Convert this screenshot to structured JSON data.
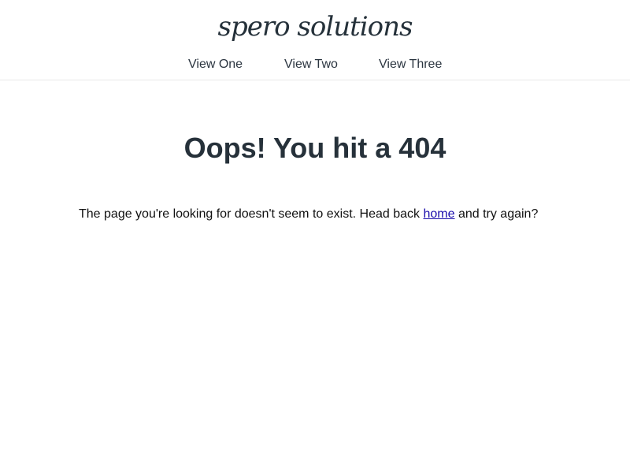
{
  "brand": {
    "name": "spero solutions"
  },
  "nav": {
    "items": [
      {
        "label": "View One"
      },
      {
        "label": "View Two"
      },
      {
        "label": "View Three"
      }
    ]
  },
  "main": {
    "title": "Oops! You hit a 404",
    "message_before": "The page you're looking for doesn't seem to exist. Head back ",
    "home_link": "home",
    "message_after": " and try again?"
  },
  "colors": {
    "text_dark": "#26313a",
    "link": "#1a0dab",
    "header_border": "#e8e8e8",
    "background": "#ffffff"
  }
}
